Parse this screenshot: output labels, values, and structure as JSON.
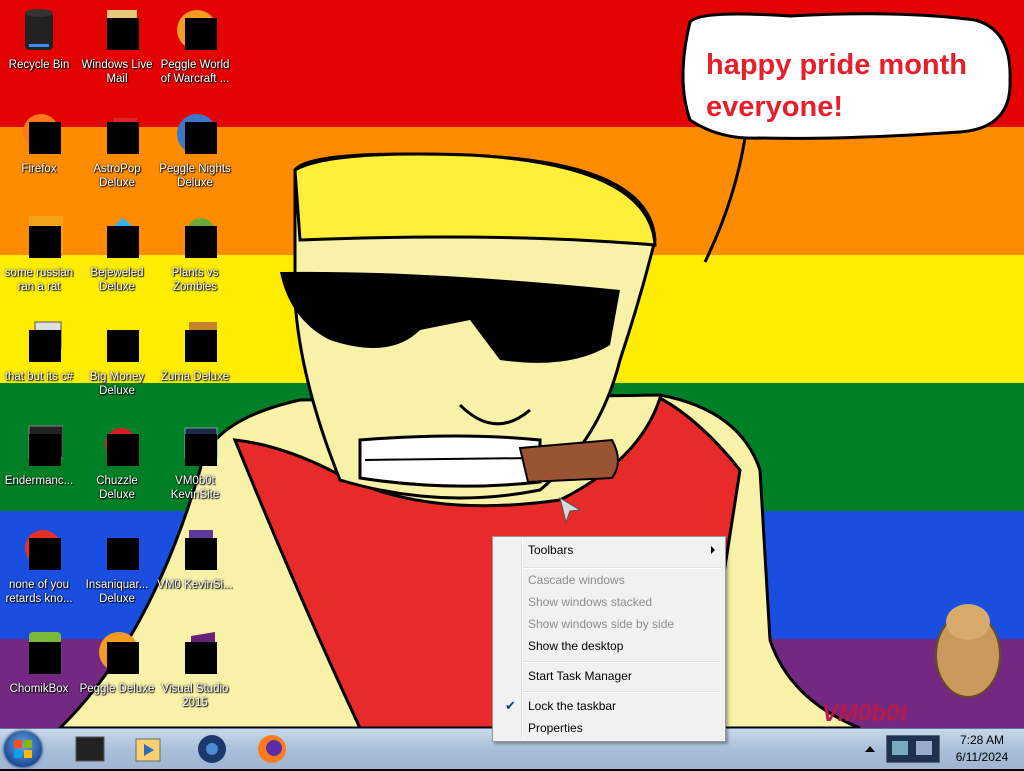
{
  "wallpaper": {
    "speech_bubble": "happy pride month everyone!",
    "signature": "VM0b0t",
    "stripe_colors": [
      "#e40303",
      "#ff8c00",
      "#ffed00",
      "#008026",
      "#1a4ee0",
      "#732982"
    ]
  },
  "desktop_icons": [
    {
      "label": "Recycle Bin",
      "icon": "recycle-bin-icon"
    },
    {
      "label": "Windows Live Mail",
      "icon": "mail-icon"
    },
    {
      "label": "Peggle World of Warcraft ...",
      "icon": "peggle-icon"
    },
    {
      "label": "Firefox",
      "icon": "firefox-icon"
    },
    {
      "label": "AstroPop Deluxe",
      "icon": "astropop-icon"
    },
    {
      "label": "Peggle Nights Deluxe",
      "icon": "peggle-icon"
    },
    {
      "label": "some russian ran a rat",
      "icon": "app-icon"
    },
    {
      "label": "Bejeweled Deluxe",
      "icon": "bejeweled-icon"
    },
    {
      "label": "Plants vs Zombies",
      "icon": "pvz-icon"
    },
    {
      "label": "that but its c#",
      "icon": "app-icon"
    },
    {
      "label": "Big Money Deluxe",
      "icon": "money-bag-icon"
    },
    {
      "label": "Zuma Deluxe",
      "icon": "zuma-icon"
    },
    {
      "label": "Endermanc...",
      "icon": "app-icon"
    },
    {
      "label": "Chuzzle Deluxe",
      "icon": "chuzzle-icon"
    },
    {
      "label": "VM0b0t KevinSite",
      "icon": "website-icon"
    },
    {
      "label": "none of you retards kno...",
      "icon": "app-icon"
    },
    {
      "label": "Insaniquar... Deluxe",
      "icon": "fish-icon"
    },
    {
      "label": "VM0 KevinSi...",
      "icon": "document-icon"
    },
    {
      "label": "ChomikBox",
      "icon": "chomikbox-icon"
    },
    {
      "label": "Peggle Deluxe",
      "icon": "peggle-icon"
    },
    {
      "label": "Visual Studio 2015",
      "icon": "visual-studio-icon"
    }
  ],
  "context_menu": {
    "items": [
      {
        "label": "Toolbars",
        "enabled": true,
        "submenu": true
      },
      {
        "label": "Cascade windows",
        "enabled": false
      },
      {
        "label": "Show windows stacked",
        "enabled": false
      },
      {
        "label": "Show windows side by side",
        "enabled": false
      },
      {
        "label": "Show the desktop",
        "enabled": true
      },
      {
        "label": "Start Task Manager",
        "enabled": true
      },
      {
        "label": "Lock the taskbar",
        "enabled": true,
        "checked": true
      },
      {
        "label": "Properties",
        "enabled": true
      }
    ]
  },
  "taskbar": {
    "pinned": [
      "console-icon",
      "media-player-icon",
      "steam-icon",
      "firefox-icon"
    ],
    "clock_time": "7:28 AM",
    "clock_date": "6/11/2024"
  }
}
